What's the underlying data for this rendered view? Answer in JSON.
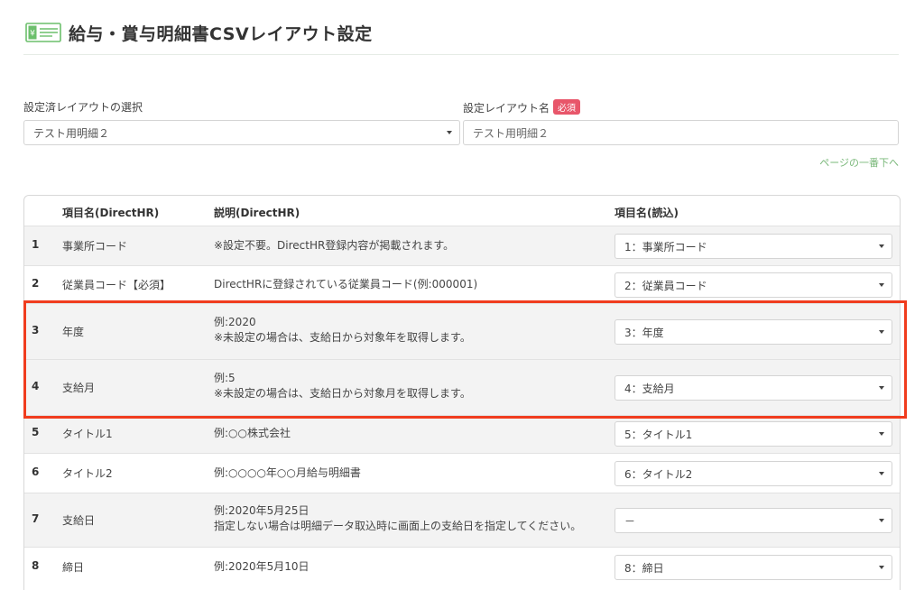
{
  "header": {
    "title": "給与・賞与明細書CSVレイアウト設定",
    "icon": "payslip-icon"
  },
  "form": {
    "layout_select_label": "設定済レイアウトの選択",
    "layout_select_value": "テスト用明細２",
    "layout_name_label": "設定レイアウト名",
    "required_badge": "必須",
    "layout_name_value": "テスト用明細２"
  },
  "page_top_link": "ページの一番下へ",
  "table": {
    "headers": {
      "item_name": "項目名(DirectHR)",
      "description": "説明(DirectHR)",
      "read_item": "項目名(読込)"
    },
    "rows": [
      {
        "num": "1",
        "name": "事業所コード",
        "desc1": "※設定不要。DirectHR登録内容が掲載されます。",
        "desc2": "",
        "select": "1：事業所コード"
      },
      {
        "num": "2",
        "name": "従業員コード【必須】",
        "desc1": "DirectHRに登録されている従業員コード(例:000001)",
        "desc2": "",
        "select": "2：従業員コード"
      },
      {
        "num": "3",
        "name": "年度",
        "desc1": "例:2020",
        "desc2": "※未設定の場合は、支給日から対象年を取得します。",
        "select": "3：年度"
      },
      {
        "num": "4",
        "name": "支給月",
        "desc1": "例:5",
        "desc2": "※未設定の場合は、支給日から対象月を取得します。",
        "select": "4：支給月"
      },
      {
        "num": "5",
        "name": "タイトル1",
        "desc1": "例:○○株式会社",
        "desc2": "",
        "select": "5：タイトル1"
      },
      {
        "num": "6",
        "name": "タイトル2",
        "desc1": "例:○○○○年○○月給与明細書",
        "desc2": "",
        "select": "6：タイトル2"
      },
      {
        "num": "7",
        "name": "支給日",
        "desc1": "例:2020年5月25日",
        "desc2": "指定しない場合は明細データ取込時に画面上の支給日を指定してください。",
        "select": "－"
      },
      {
        "num": "8",
        "name": "締日",
        "desc1": "例:2020年5月10日",
        "desc2": "",
        "select": "8：締日"
      }
    ]
  },
  "colors": {
    "highlight": "#f03c1e",
    "accent_green": "#7ab87a",
    "badge": "#e8566a"
  }
}
